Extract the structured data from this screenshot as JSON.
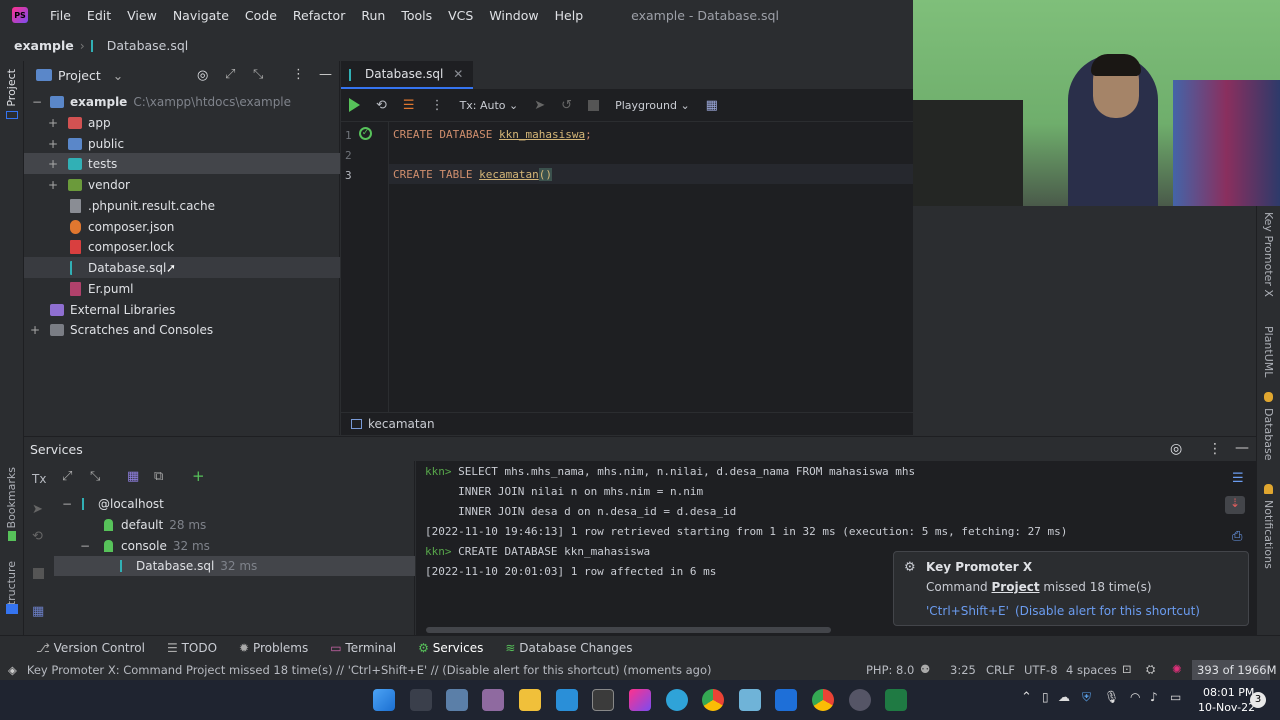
{
  "menubar": {
    "items": [
      "File",
      "Edit",
      "View",
      "Navigate",
      "Code",
      "Refactor",
      "Run",
      "Tools",
      "VCS",
      "Window",
      "Help"
    ],
    "title": "example - Database.sql"
  },
  "navbar": {
    "project": "example",
    "file": "Database.sql"
  },
  "left_strip": {
    "project": "Project",
    "bookmarks": "Bookmarks",
    "structure": "Structure"
  },
  "project_panel": {
    "header": "Project",
    "root": {
      "name": "example",
      "path": "C:\\xampp\\htdocs\\example"
    },
    "items": [
      {
        "label": "app",
        "icon": "folder-red-icon"
      },
      {
        "label": "public",
        "icon": "folder-blue-icon"
      },
      {
        "label": "tests",
        "icon": "folder-cyan-icon"
      },
      {
        "label": "vendor",
        "icon": "folder-green-icon"
      },
      {
        "label": ".phpunit.result.cache",
        "icon": "file-icon"
      },
      {
        "label": "composer.json",
        "icon": "composer-icon"
      },
      {
        "label": "composer.lock",
        "icon": "lock-icon"
      },
      {
        "label": "Database.sql",
        "icon": "sql-file-icon"
      },
      {
        "label": "Er.puml",
        "icon": "puml-file-icon"
      }
    ],
    "external": "External Libraries",
    "scratches": "Scratches and Consoles"
  },
  "editor": {
    "tab": "Database.sql",
    "tx": "Tx: Auto",
    "playground": "Playground",
    "lines": [
      {
        "num": "1",
        "kw1": "CREATE DATABASE ",
        "id": "kkn_mahasiswa",
        "rest": ";"
      },
      {
        "num": "2"
      },
      {
        "num": "3",
        "kw1": "CREATE TABLE ",
        "id": "kecamatan",
        "rest": "()"
      }
    ],
    "breadcrumb": "kecamatan"
  },
  "right_strip": {
    "key_promoter": "Key Promoter X",
    "plantuml": "PlantUML",
    "database": "Database",
    "notifications": "Notifications"
  },
  "services": {
    "title": "Services",
    "tx": "Tx",
    "tree": [
      {
        "label": "@localhost"
      },
      {
        "label": "default",
        "time": "28 ms"
      },
      {
        "label": "console",
        "time": "32 ms"
      },
      {
        "label": "Database.sql",
        "time": "32 ms"
      }
    ],
    "console": [
      {
        "prompt": "kkn>",
        "text": " SELECT mhs.mhs_nama, mhs.nim, n.nilai, d.desa_nama FROM mahasiswa mhs"
      },
      {
        "text": "     INNER JOIN nilai n on mhs.nim = n.nim"
      },
      {
        "text": "     INNER JOIN desa d on n.desa_id = d.desa_id"
      },
      {
        "text": "[2022-11-10 19:46:13] 1 row retrieved starting from 1 in 32 ms (execution: 5 ms, fetching: 27 ms)"
      },
      {
        "prompt": "kkn>",
        "text": " CREATE DATABASE kkn_mahasiswa"
      },
      {
        "text": "[2022-11-10 20:01:03] 1 row affected in 6 ms"
      }
    ]
  },
  "key_promoter_popup": {
    "title": "Key Promoter X",
    "msg_pre": "Command ",
    "msg_link": "Project",
    "msg_post": " missed 18 time(s)",
    "shortcut": "'Ctrl+Shift+E'",
    "disable": "(Disable alert for this shortcut)"
  },
  "bottom_tabs": [
    "Version Control",
    "TODO",
    "Problems",
    "Terminal",
    "Services",
    "Database Changes"
  ],
  "statusbar": {
    "message": "Key Promoter X: Command Project missed 18 time(s) // 'Ctrl+Shift+E' // (Disable alert for this shortcut) (moments ago)",
    "php": "PHP: 8.0",
    "pos": "3:25",
    "eol": "CRLF",
    "enc": "UTF-8",
    "indent": "4 spaces",
    "memory": "393 of 1966M"
  },
  "taskbar": {
    "time": "08:01 PM",
    "date": "10-Nov-22",
    "badge": "3"
  },
  "colors": {
    "accent": "#3574f0",
    "run": "#57c25a",
    "keyword": "#cf8e6d",
    "identifier": "#d5b778"
  }
}
